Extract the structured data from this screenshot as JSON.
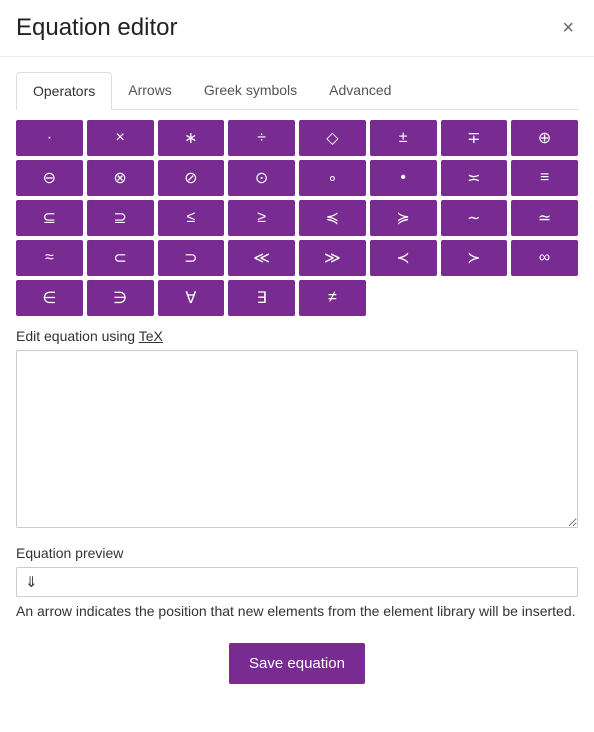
{
  "header": {
    "title": "Equation editor",
    "close_glyph": "×"
  },
  "tabs": [
    {
      "label": "Operators",
      "active": true
    },
    {
      "label": "Arrows",
      "active": false
    },
    {
      "label": "Greek symbols",
      "active": false
    },
    {
      "label": "Advanced",
      "active": false
    }
  ],
  "symbols": [
    "·",
    "×",
    "∗",
    "÷",
    "◇",
    "±",
    "∓",
    "⊕",
    "⊖",
    "⊗",
    "⊘",
    "⊙",
    "∘",
    "•",
    "≍",
    "≡",
    "⊆",
    "⊇",
    "≤",
    "≥",
    "≼",
    "≽",
    "∼",
    "≃",
    "≈",
    "⊂",
    "⊃",
    "≪",
    "≫",
    "≺",
    "≻",
    "∞",
    "∈",
    "∋",
    "∀",
    "∃",
    "≠"
  ],
  "edit_label_pre": "Edit equation using ",
  "edit_label_link": "TeX",
  "editor_value": "",
  "preview_label": "Equation preview",
  "preview_content": "⇓",
  "hint": "An arrow indicates the position that new elements from the element library will be inserted.",
  "save_label": "Save equation",
  "colors": {
    "accent": "#782b90"
  }
}
